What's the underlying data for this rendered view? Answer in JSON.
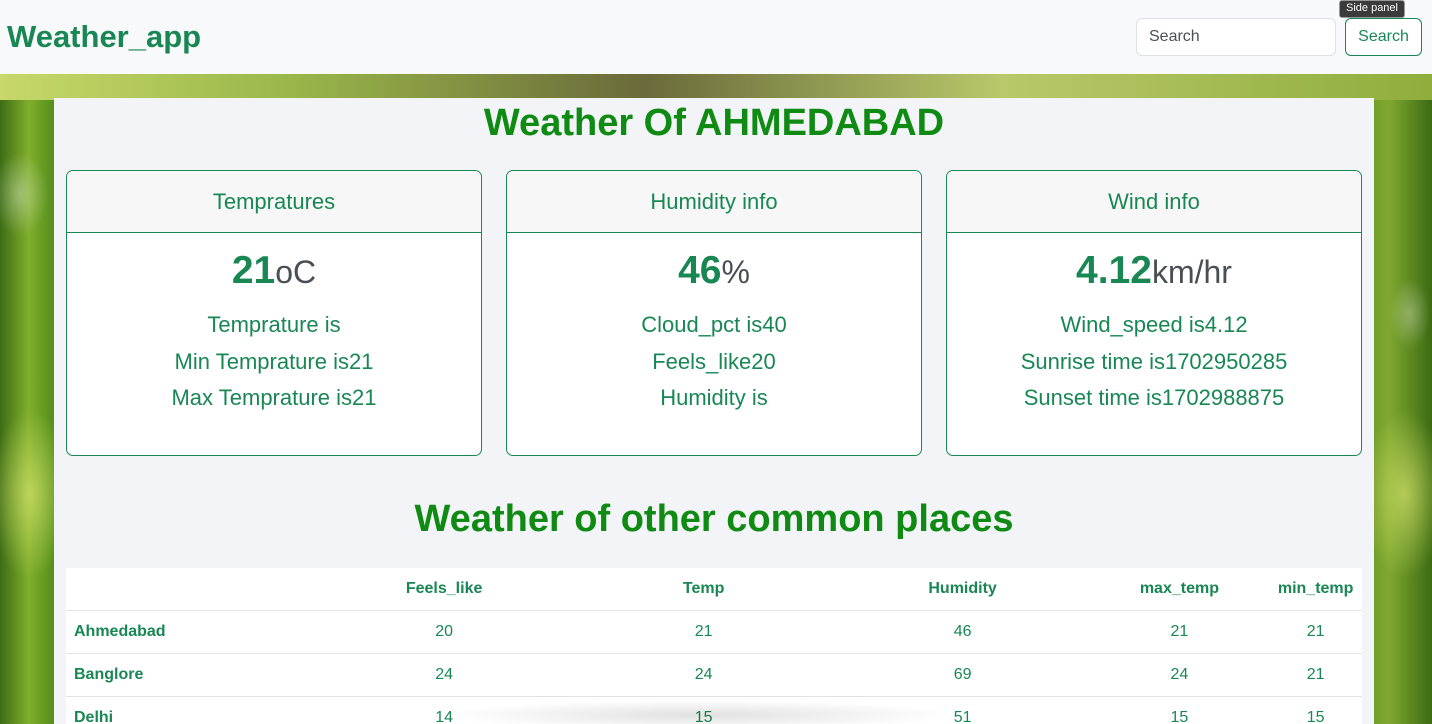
{
  "navbar": {
    "brand": "Weather_app",
    "search_placeholder": "Search",
    "search_button": "Search",
    "tooltip": "Side panel"
  },
  "main": {
    "title": "Weather Of AHMEDABAD",
    "cards": [
      {
        "header": "Tempratures",
        "value": "21",
        "unit": "oC",
        "lines": [
          "Temprature is",
          "Min Temprature is21",
          "Max Temprature is21"
        ]
      },
      {
        "header": "Humidity info",
        "value": "46",
        "unit": "%",
        "lines": [
          "Cloud_pct is40",
          "Feels_like20",
          "Humidity is"
        ]
      },
      {
        "header": "Wind info",
        "value": "4.12",
        "unit": "km/hr",
        "lines": [
          "Wind_speed is4.12",
          "Sunrise time is1702950285",
          "Sunset time is1702988875"
        ]
      }
    ],
    "section_title": "Weather of other common places",
    "table": {
      "headers": [
        "",
        "Feels_like",
        "Temp",
        "Humidity",
        "max_temp",
        "min_temp"
      ],
      "rows": [
        [
          "Ahmedabad",
          "20",
          "21",
          "46",
          "21",
          "21"
        ],
        [
          "Banglore",
          "24",
          "24",
          "69",
          "24",
          "21"
        ],
        [
          "Delhi",
          "14",
          "15",
          "51",
          "15",
          "15"
        ]
      ]
    }
  },
  "colors": {
    "brand": "#198754",
    "title": "#0f8a12",
    "panel_bg": "#f3f4f7"
  }
}
